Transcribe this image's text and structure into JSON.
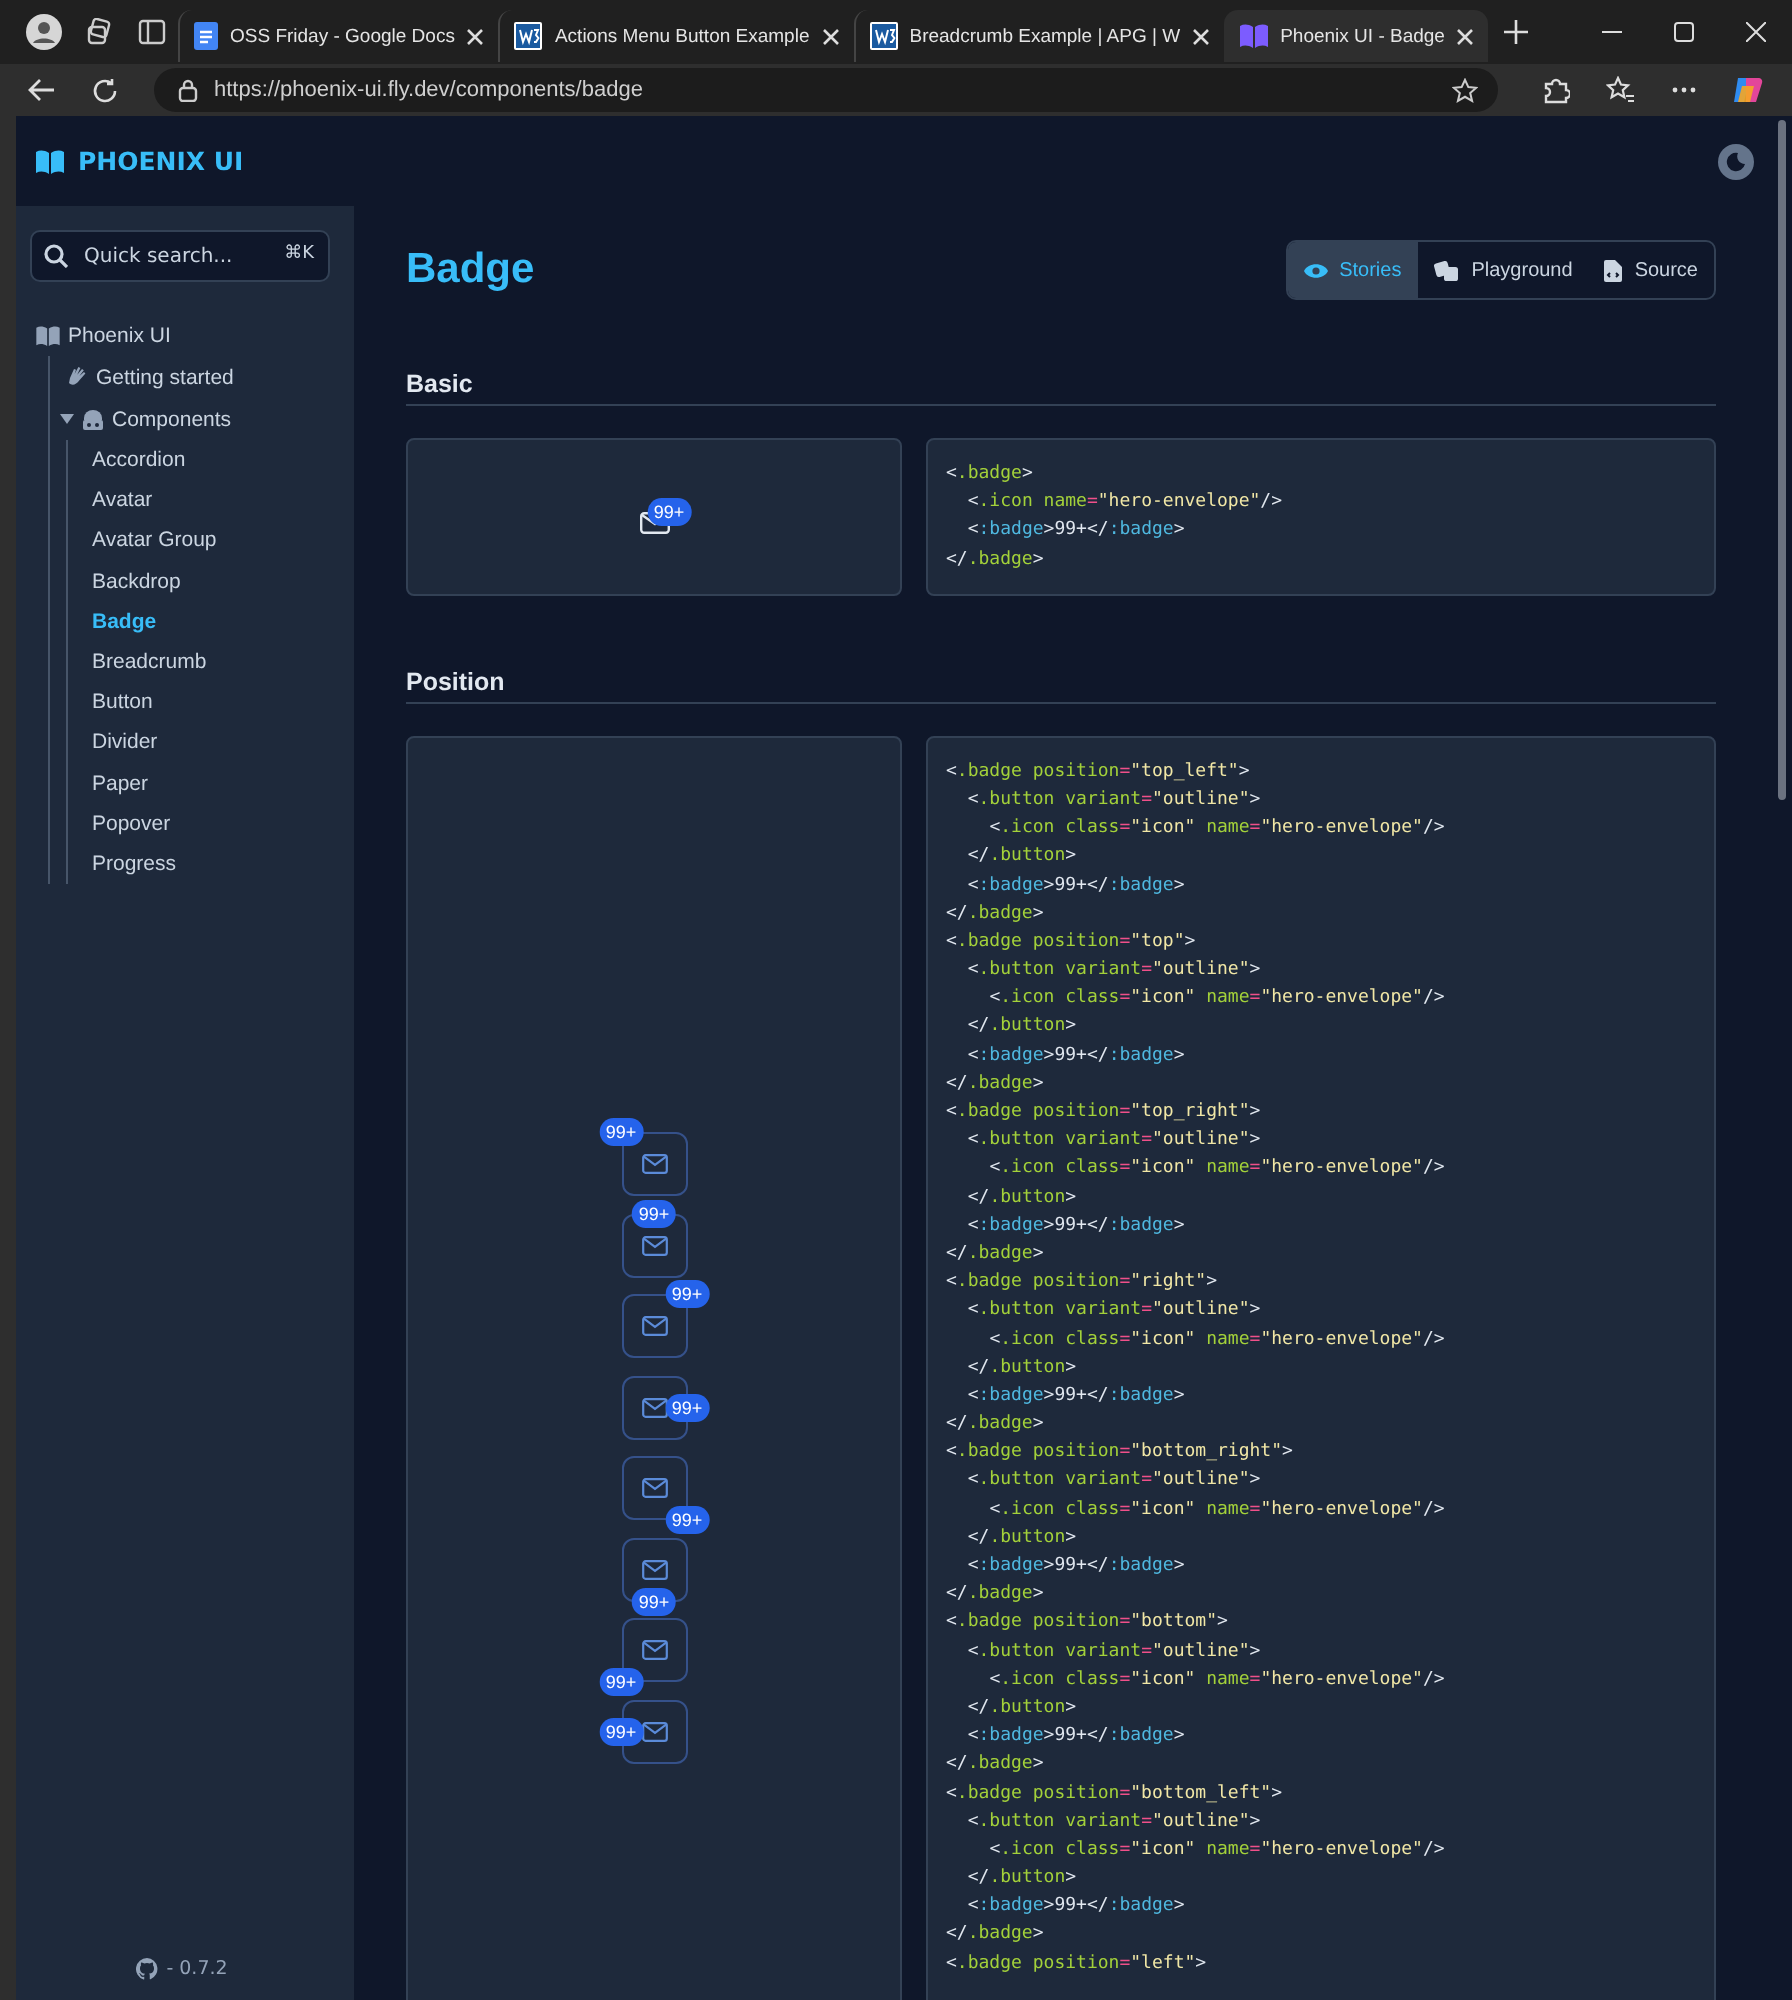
{
  "browser": {
    "tabs": [
      {
        "title": "OSS Friday - Google Docs",
        "selected": false
      },
      {
        "title": "Actions Menu Button Example",
        "selected": false
      },
      {
        "title": "Breadcrumb Example | APG | W",
        "selected": false
      },
      {
        "title": "Phoenix UI - Badge",
        "selected": true
      }
    ],
    "address": "https://phoenix-ui.fly.dev/components/badge"
  },
  "header": {
    "logo": "PHOENIX UI"
  },
  "sidebar": {
    "search": {
      "placeholder": "Quick search...",
      "shortcut": "⌘K"
    },
    "tree": [
      {
        "label": "Phoenix UI",
        "children": [
          {
            "label": "Getting started"
          },
          {
            "label": "Components",
            "expanded": true,
            "children": [
              {
                "label": "Accordion",
                "selected": false
              },
              {
                "label": "Avatar",
                "selected": false
              },
              {
                "label": "Avatar Group",
                "selected": false
              },
              {
                "label": "Backdrop",
                "selected": false
              },
              {
                "label": "Badge",
                "selected": true
              },
              {
                "label": "Breadcrumb",
                "selected": false
              },
              {
                "label": "Button",
                "selected": false
              },
              {
                "label": "Divider",
                "selected": false
              },
              {
                "label": "Paper",
                "selected": false
              },
              {
                "label": "Popover",
                "selected": false
              },
              {
                "label": "Progress",
                "selected": false
              }
            ]
          }
        ]
      }
    ],
    "version": "- 0.7.2"
  },
  "page": {
    "title": "Badge",
    "view_tabs": [
      {
        "label": "Stories",
        "selected": true
      },
      {
        "label": "Playground",
        "selected": false
      },
      {
        "label": "Source",
        "selected": false
      }
    ],
    "sections": [
      {
        "title": "Basic",
        "kind": "plain",
        "examples": [
          {
            "kind": "top_right",
            "badge": "99+"
          }
        ],
        "code": [
          "<.badge>",
          "  <.icon name=\"hero-envelope\"/>",
          "  <:badge>99+</:badge>",
          "</.badge>"
        ]
      },
      {
        "title": "Position",
        "kind": "outline",
        "examples": [
          {
            "kind": "top_left",
            "badge": "99+"
          },
          {
            "kind": "top",
            "badge": "99+"
          },
          {
            "kind": "top_right",
            "badge": "99+"
          },
          {
            "kind": "right",
            "badge": "99+"
          },
          {
            "kind": "bottom_right",
            "badge": "99+"
          },
          {
            "kind": "bottom",
            "badge": "99+"
          },
          {
            "kind": "bottom_left",
            "badge": "99+"
          },
          {
            "kind": "left",
            "badge": "99+"
          }
        ],
        "code": [
          "<.badge position=\"top_left\">",
          "  <.button variant=\"outline\">",
          "    <.icon class=\"icon\" name=\"hero-envelope\"/>",
          "  </.button>",
          "  <:badge>99+</:badge>",
          "</.badge>",
          "<.badge position=\"top\">",
          "  <.button variant=\"outline\">",
          "    <.icon class=\"icon\" name=\"hero-envelope\"/>",
          "  </.button>",
          "  <:badge>99+</:badge>",
          "</.badge>",
          "<.badge position=\"top_right\">",
          "  <.button variant=\"outline\">",
          "    <.icon class=\"icon\" name=\"hero-envelope\"/>",
          "  </.button>",
          "  <:badge>99+</:badge>",
          "</.badge>",
          "<.badge position=\"right\">",
          "  <.button variant=\"outline\">",
          "    <.icon class=\"icon\" name=\"hero-envelope\"/>",
          "  </.button>",
          "  <:badge>99+</:badge>",
          "</.badge>",
          "<.badge position=\"bottom_right\">",
          "  <.button variant=\"outline\">",
          "    <.icon class=\"icon\" name=\"hero-envelope\"/>",
          "  </.button>",
          "  <:badge>99+</:badge>",
          "</.badge>",
          "<.badge position=\"bottom\">",
          "  <.button variant=\"outline\">",
          "    <.icon class=\"icon\" name=\"hero-envelope\"/>",
          "  </.button>",
          "  <:badge>99+</:badge>",
          "</.badge>",
          "<.badge position=\"bottom_left\">",
          "  <.button variant=\"outline\">",
          "    <.icon class=\"icon\" name=\"hero-envelope\"/>",
          "  </.button>",
          "  <:badge>99+</:badge>",
          "</.badge>",
          "<.badge position=\"left\">"
        ]
      }
    ]
  }
}
